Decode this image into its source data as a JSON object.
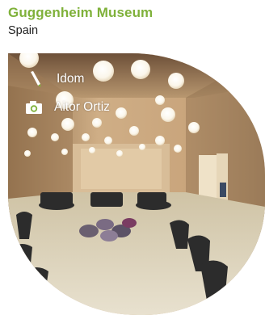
{
  "header": {
    "title": "Guggenheim Museum",
    "subtitle": "Spain"
  },
  "photo": {
    "subject": "museum-interior",
    "credits": [
      {
        "icon": "pencil-icon",
        "label": "Idom"
      },
      {
        "icon": "camera-icon",
        "label": "Aitor Ortiz"
      }
    ]
  },
  "colors": {
    "title": "#7fb13a",
    "text": "#222222",
    "credit_text": "#ffffff"
  }
}
